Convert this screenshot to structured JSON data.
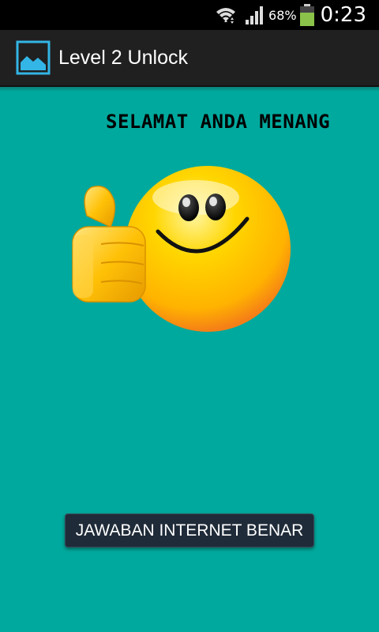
{
  "status_bar": {
    "battery_percent": "68%",
    "battery_level": 0.68,
    "time": "0:23",
    "icons": [
      "wifi-icon",
      "signal-icon",
      "battery-icon"
    ],
    "colors": {
      "battery_fill": "#8BC34A"
    }
  },
  "action_bar": {
    "title": "Level 2 Unlock",
    "icon": "app-image-icon",
    "colors": {
      "background": "#202020",
      "icon_accent": "#33B5E5"
    }
  },
  "content": {
    "win_message": "SELAMAT ANDA MENANG",
    "image": "thumbs-up-smiley",
    "button_label": "JAWABAN INTERNET BENAR",
    "colors": {
      "background": "#00A99D",
      "button": "#1F2B38"
    }
  }
}
